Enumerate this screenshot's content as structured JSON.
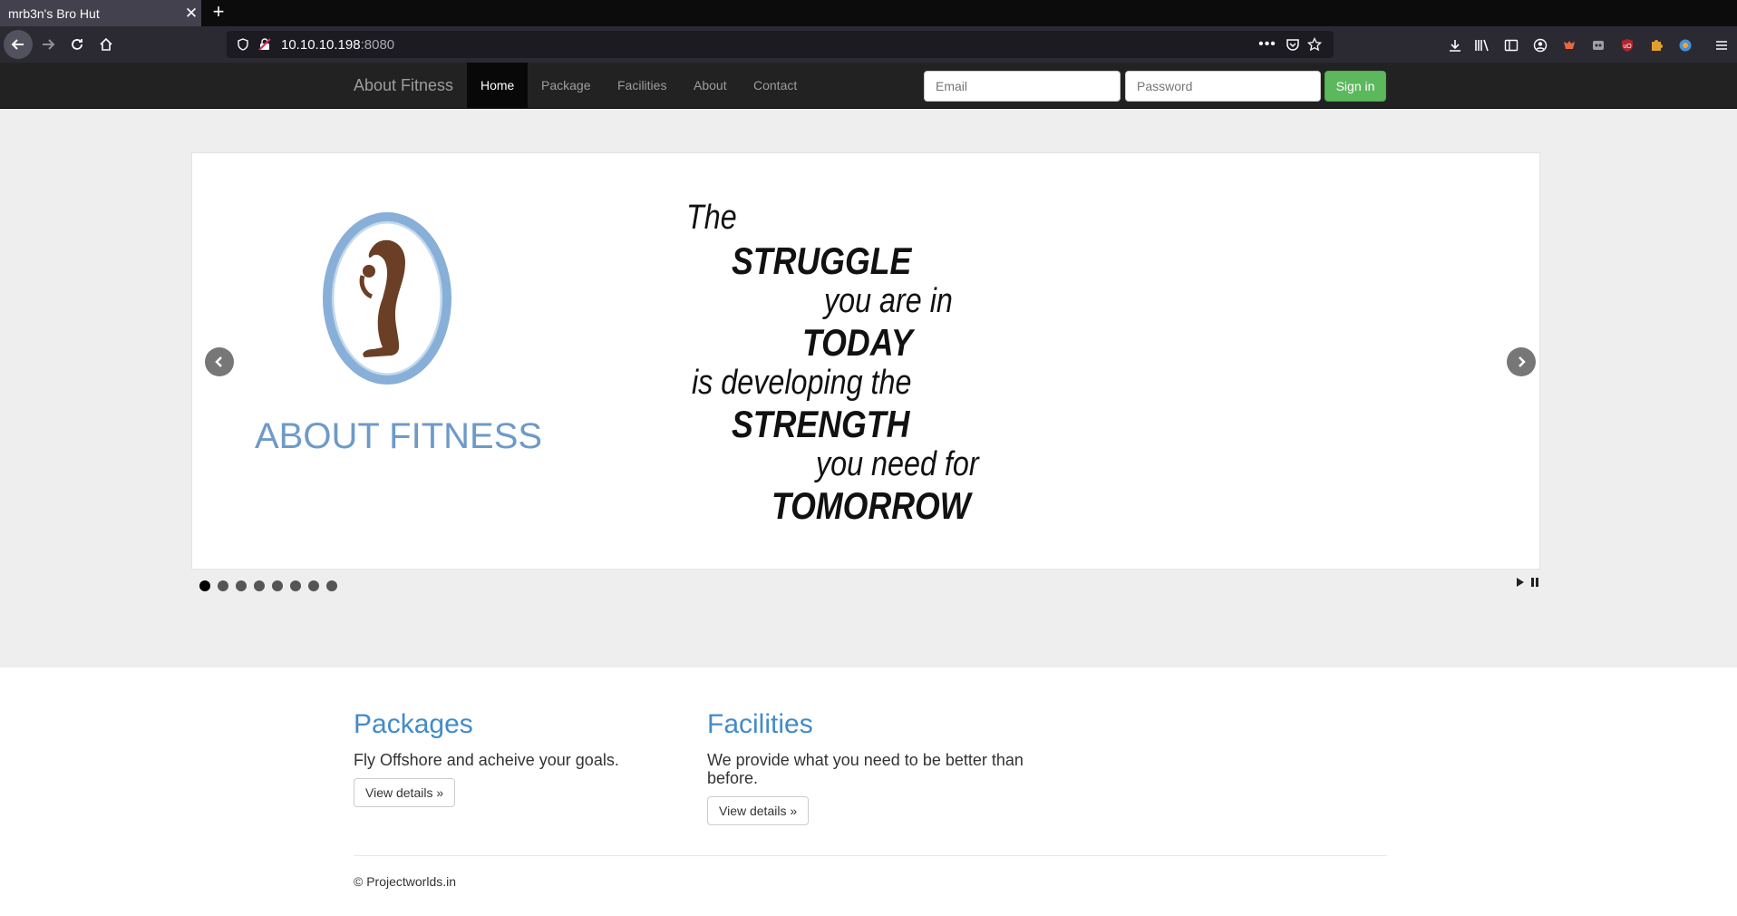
{
  "browser": {
    "tab_title": "mrb3n's Bro Hut",
    "url_host": "10.10.10.198",
    "url_port": ":8080"
  },
  "nav": {
    "brand": "About Fitness",
    "links": [
      "Home",
      "Package",
      "Facilities",
      "About",
      "Contact"
    ],
    "active": "Home",
    "email_placeholder": "Email",
    "password_placeholder": "Password",
    "signin_label": "Sign in"
  },
  "slider": {
    "logo_text": "ABOUT FITNESS",
    "quote_lines": [
      "The",
      "STRUGGLE",
      "you are in",
      "TODAY",
      "is developing the",
      "STRENGTH",
      "you need for",
      "TOMORROW"
    ],
    "dot_count": 8,
    "active_dot": 0,
    "colors": {
      "logo_ring": "#7aa6d3",
      "figure": "#6b3e26"
    }
  },
  "content": {
    "packages": {
      "title": "Packages",
      "text": "Fly Offshore and acheive your goals.",
      "button": "View details »"
    },
    "facilities": {
      "title": "Facilities",
      "text": "We provide what you need to be better than before.",
      "button": "View details »"
    }
  },
  "footer": {
    "text": "© Projectworlds.in"
  }
}
